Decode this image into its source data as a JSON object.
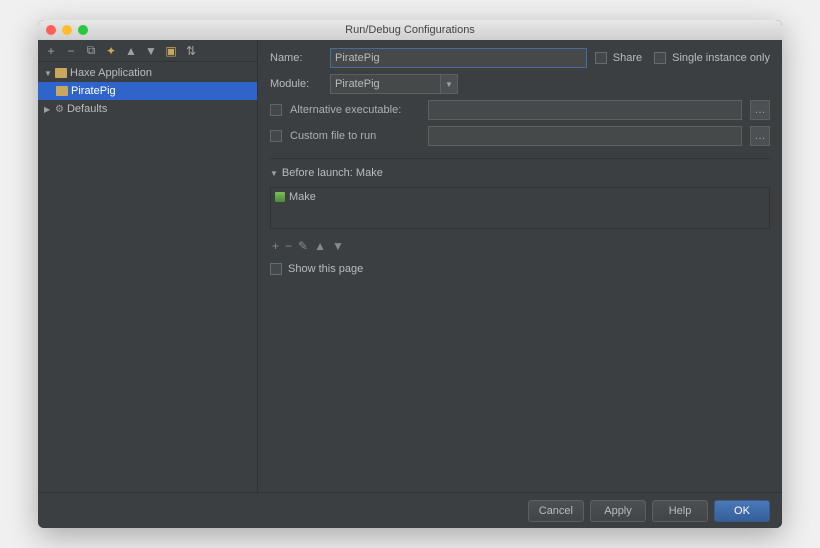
{
  "window": {
    "title": "Run/Debug Configurations"
  },
  "sidebar": {
    "items": [
      {
        "label": "Haxe Application"
      },
      {
        "label": "PiratePig"
      },
      {
        "label": "Defaults"
      }
    ]
  },
  "form": {
    "name_label": "Name:",
    "name_value": "PiratePig",
    "share_label": "Share",
    "single_instance_label": "Single instance only",
    "module_label": "Module:",
    "module_value": "PiratePig",
    "alt_exec_label": "Alternative executable:",
    "custom_file_label": "Custom file to run",
    "before_launch_header": "Before launch: Make",
    "before_launch_item": "Make",
    "show_page_label": "Show this page"
  },
  "buttons": {
    "cancel": "Cancel",
    "apply": "Apply",
    "help": "Help",
    "ok": "OK"
  }
}
